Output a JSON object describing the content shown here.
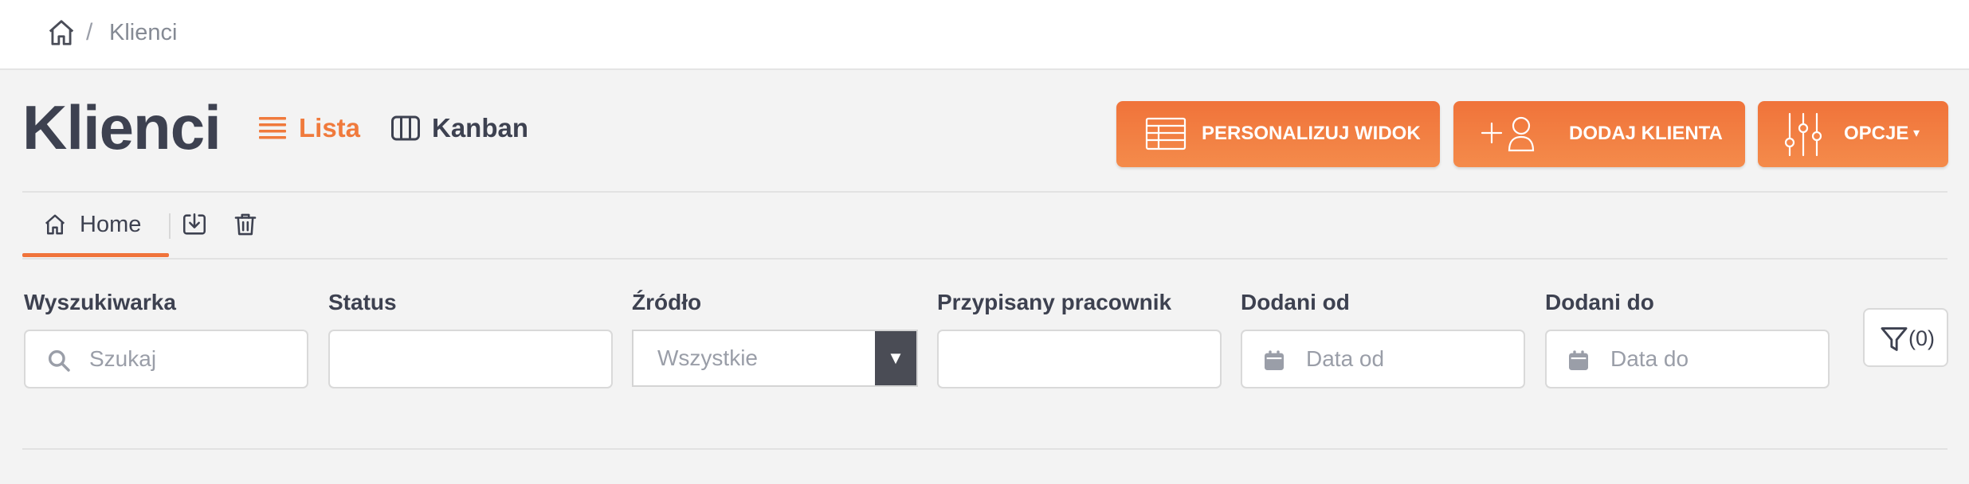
{
  "breadcrumb": {
    "home_icon": "home-icon",
    "separator": "/",
    "current": "Klienci"
  },
  "page": {
    "title": "Klienci"
  },
  "views": {
    "list_label": "Lista",
    "list_icon": "list-icon",
    "kanban_label": "Kanban",
    "kanban_icon": "kanban-columns-icon"
  },
  "actions": {
    "personalize_label": "PERSONALIZUJ WIDOK",
    "personalize_icon": "table-icon",
    "add_client_label": "DODAJ KLIENTA",
    "add_client_icon": "add-user-icon",
    "options_label": "OPCJE",
    "options_icon": "sliders-icon"
  },
  "tabs": {
    "home_label": "Home",
    "home_icon": "home-icon",
    "save_icon": "download-box-icon",
    "delete_icon": "trash-icon"
  },
  "filters": {
    "search_label": "Wyszukiwarka",
    "search_placeholder": "Szukaj",
    "status_label": "Status",
    "status_value": "",
    "source_label": "Źródło",
    "source_value": "Wszystkie",
    "employee_label": "Przypisany pracownik",
    "employee_value": "",
    "date_from_label": "Dodani od",
    "date_from_placeholder": "Data od",
    "date_to_label": "Dodani do",
    "date_to_placeholder": "Data do",
    "filter_count": "(0)"
  },
  "colors": {
    "accent": "#f0733a",
    "text_dark": "#3d4150",
    "muted": "#9a9ea8",
    "background": "#f3f3f3"
  }
}
